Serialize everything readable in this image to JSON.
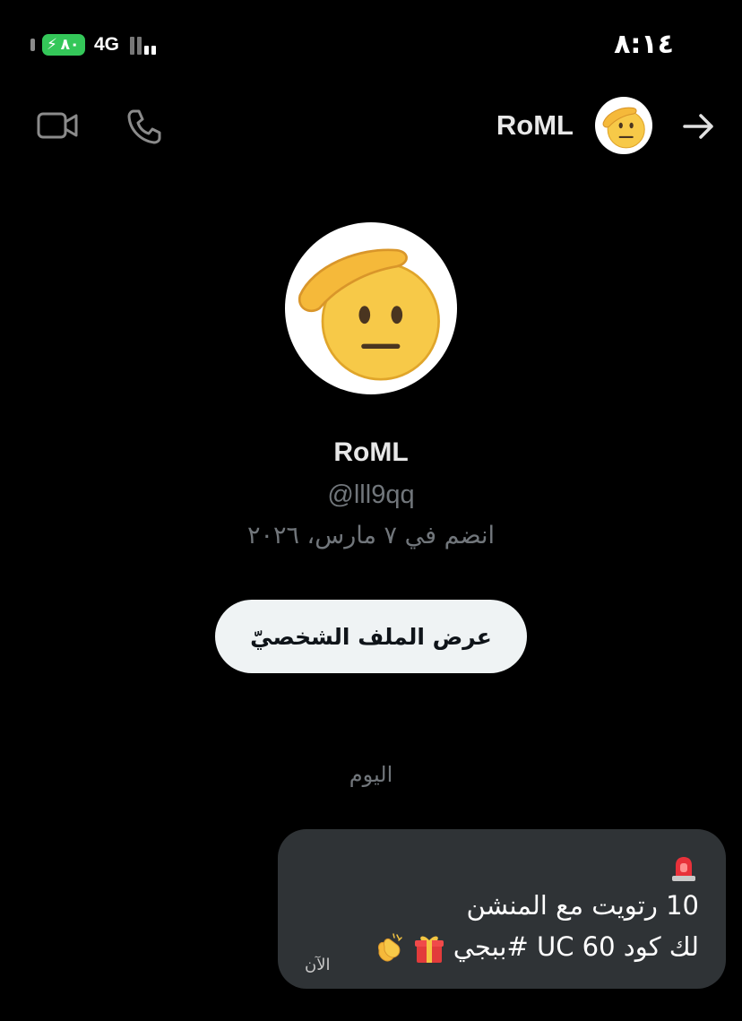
{
  "status_bar": {
    "battery": "٨٠",
    "network": "4G",
    "time": "٨:١٤"
  },
  "header": {
    "name": "RoML",
    "icons": [
      "video-icon",
      "phone-icon",
      "arrow-right-icon"
    ]
  },
  "profile": {
    "name": "RoML",
    "handle": "@lll9qq",
    "joined": "انضم في ٧ مارس، ٢٠٢٦",
    "view_profile_label": "عرض الملف الشخصيّ",
    "avatar_icon": "saluting-face-emoji"
  },
  "date_divider": "اليوم",
  "message": {
    "line1_icon": "rotating-light-emoji",
    "line2": "10 رتويت مع المنشن",
    "line3": "لك كود 60 UC #ببجي",
    "emojis": [
      "gift-emoji",
      "clapping-hands-emoji"
    ],
    "time": "الآن"
  },
  "colors": {
    "background": "#000000",
    "bubble": "#2f3336",
    "secondary_text": "#71767b",
    "button_bg": "#eff3f4",
    "battery": "#34c759"
  }
}
